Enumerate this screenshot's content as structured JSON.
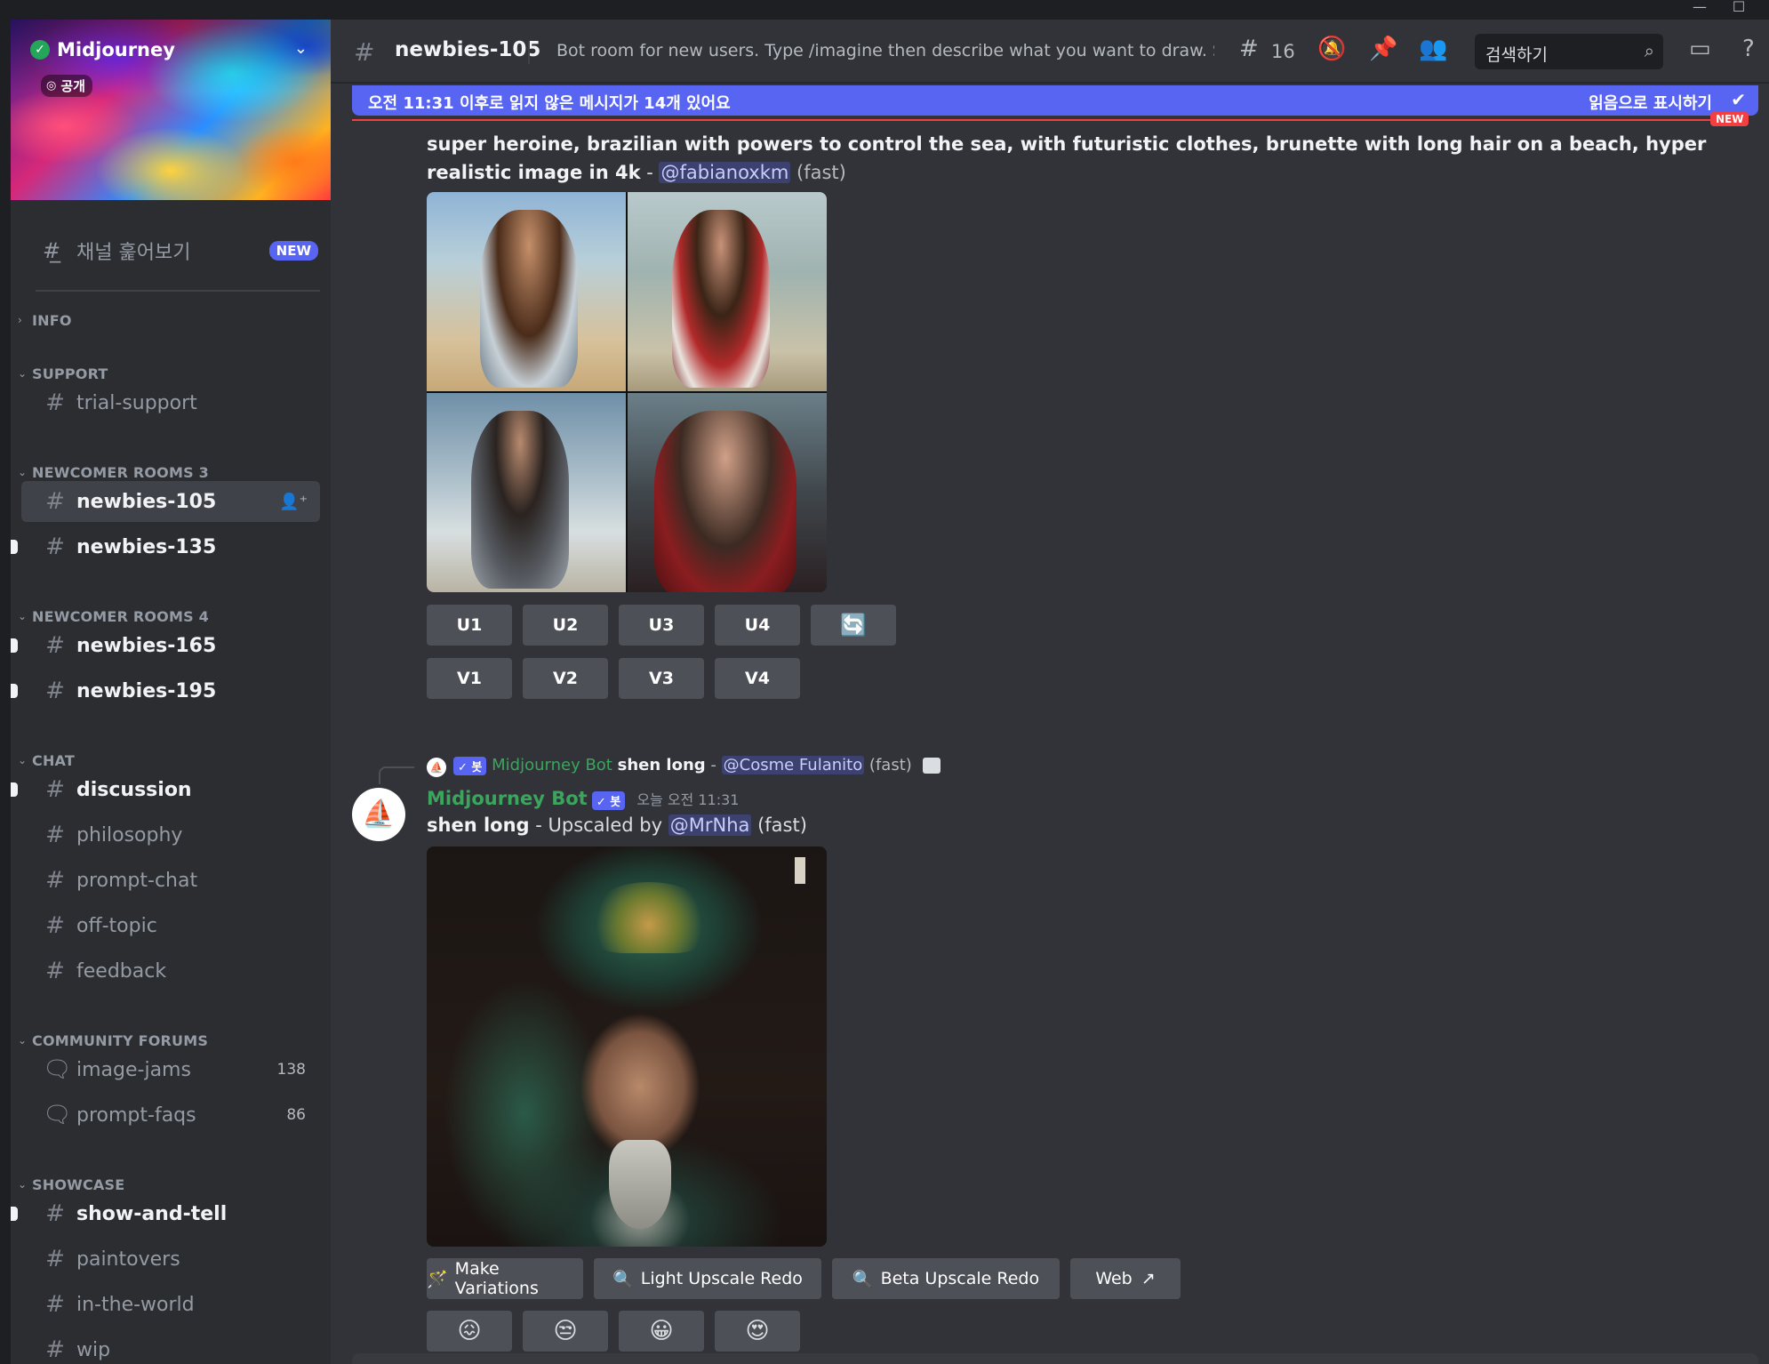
{
  "window": {
    "minimize": "—",
    "maximize": "☐"
  },
  "server": {
    "name": "Midjourney",
    "visibility": "공개"
  },
  "sidebar": {
    "browse_channels": "채널 훑어보기",
    "new_badge": "NEW",
    "categories": {
      "info": "INFO",
      "support": "SUPPORT",
      "newcomer3": "NEWCOMER ROOMS 3",
      "newcomer4": "NEWCOMER ROOMS 4",
      "chat": "CHAT",
      "forums": "COMMUNITY FORUMS",
      "showcase": "SHOWCASE"
    },
    "channels": {
      "trial_support": "trial-support",
      "newbies_105": "newbies-105",
      "newbies_135": "newbies-135",
      "newbies_165": "newbies-165",
      "newbies_195": "newbies-195",
      "discussion": "discussion",
      "philosophy": "philosophy",
      "prompt_chat": "prompt-chat",
      "off_topic": "off-topic",
      "feedback": "feedback",
      "image_jams": "image-jams",
      "image_jams_count": "138",
      "prompt_faqs": "prompt-faqs",
      "prompt_faqs_count": "86",
      "show_and_tell": "show-and-tell",
      "paintovers": "paintovers",
      "in_the_world": "in-the-world",
      "wip": "wip"
    }
  },
  "header": {
    "channel": "newbies-105",
    "topic": "Bot room for new users. Type /imagine then describe what you want to draw. See ...",
    "threads_count": "16",
    "search_placeholder": "검색하기"
  },
  "unread": {
    "text": "오전 11:31 이후로 읽지 않은 메시지가 14개 있어요",
    "mark_read": "읽음으로 표시하기",
    "new_tag": "NEW"
  },
  "message1": {
    "prompt": "super heroine, brazilian with powers to control the sea, with futuristic clothes, brunette with long hair on a beach, hyper realistic image in 4k",
    "dash": " - ",
    "mention": "@fabianoxkm",
    "speed": " (fast)",
    "buttons": {
      "u1": "U1",
      "u2": "U2",
      "u3": "U3",
      "u4": "U4",
      "v1": "V1",
      "v2": "V2",
      "v3": "V3",
      "v4": "V4",
      "reroll": "🔄"
    }
  },
  "message2": {
    "reply": {
      "bot_name": "Midjourney Bot",
      "bot_tag": "✓ 봇",
      "prompt": "shen long",
      "dash": " - ",
      "mention": "@Cosme Fulanito",
      "speed": " (fast)"
    },
    "author": "Midjourney Bot",
    "bot_tag": "✓ 봇",
    "timestamp": "오늘 오전 11:31",
    "prompt": "shen long",
    "upscaled_by": " - Upscaled by ",
    "mention": "@MrNha",
    "speed": " (fast)",
    "buttons": {
      "make_variations": "Make Variations",
      "light_upscale": "Light Upscale Redo",
      "beta_upscale": "Beta Upscale Redo",
      "web": "Web"
    },
    "reactions": [
      "😖",
      "😒",
      "😀",
      "😍"
    ]
  }
}
